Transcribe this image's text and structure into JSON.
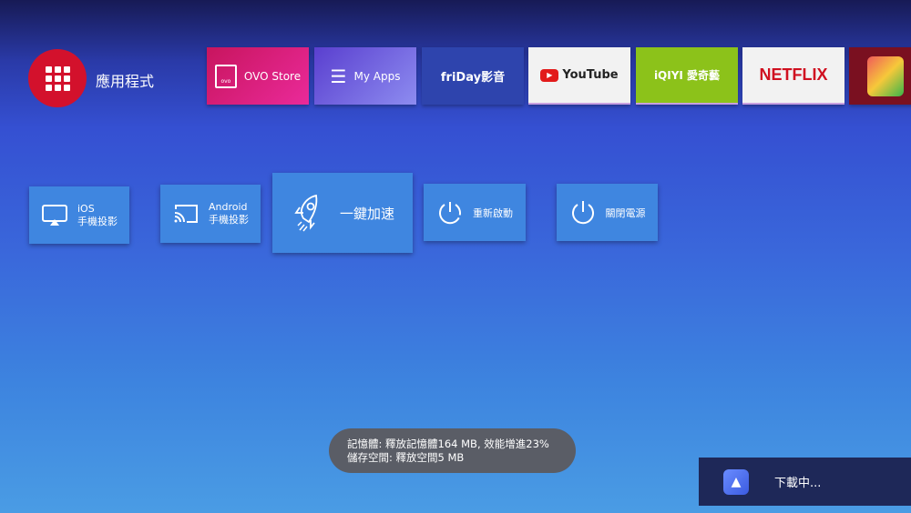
{
  "apps_button": {
    "label": "應用程式"
  },
  "top_tiles": [
    {
      "label": "OVO Store",
      "icon_text": "ovo",
      "color": "#d8196e"
    },
    {
      "label": "My Apps",
      "color": "#6a4fd6"
    },
    {
      "label": "friDay影音",
      "color": "#2e44ad"
    },
    {
      "label": "YouTube",
      "color": "#f1f1f1"
    },
    {
      "label": "iQIYI 愛奇藝",
      "color": "#8cc21a"
    },
    {
      "label": "NETFLIX",
      "color": "#f1f1f1"
    },
    {
      "label": "",
      "color": "#7a1020"
    }
  ],
  "actions": [
    {
      "line1": "iOS",
      "line2": "手機投影"
    },
    {
      "line1": "Android",
      "line2": "手機投影"
    },
    {
      "line1": "一鍵加速"
    },
    {
      "line1": "重新啟動"
    },
    {
      "line1": "關閉電源"
    }
  ],
  "toast": {
    "line1": "記憶體: 釋放記憶體164 MB, 效能增進23%",
    "line2": "儲存空間: 釋放空間5 MB"
  },
  "download": {
    "label": "下載中..."
  }
}
